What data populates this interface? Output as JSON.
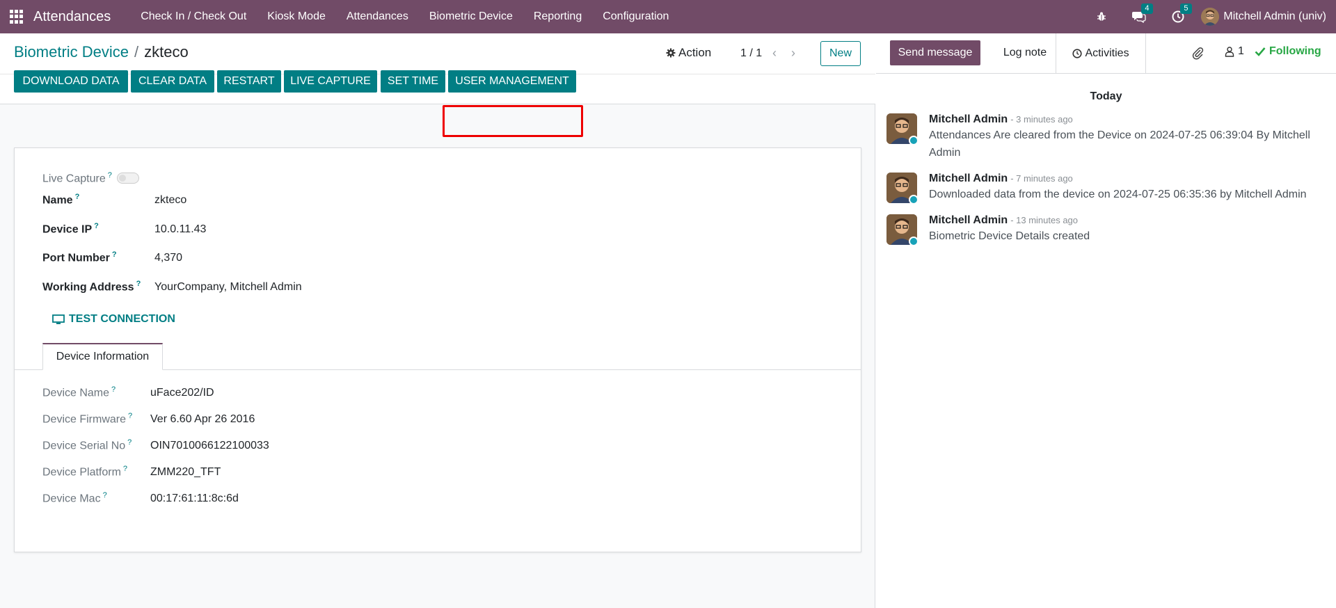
{
  "navbar": {
    "app_title": "Attendances",
    "menu": [
      "Check In / Check Out",
      "Kiosk Mode",
      "Attendances",
      "Biometric Device",
      "Reporting",
      "Configuration"
    ],
    "messages_badge": "4",
    "activities_badge": "5",
    "user_name": "Mitchell Admin (univ)"
  },
  "control": {
    "breadcrumb_parent": "Biometric Device",
    "breadcrumb_sep": "/",
    "breadcrumb_current": "zkteco",
    "action_label": "Action",
    "pager": "1 / 1",
    "new_label": "New"
  },
  "header_buttons": [
    "DOWNLOAD DATA",
    "CLEAR DATA",
    "RESTART",
    "LIVE CAPTURE",
    "SET TIME",
    "USER MANAGEMENT"
  ],
  "form": {
    "live_capture_label": "Live Capture",
    "live_capture_value": false,
    "name_label": "Name",
    "name_value": "zkteco",
    "ip_label": "Device IP",
    "ip_value": "10.0.11.43",
    "port_label": "Port Number",
    "port_value": "4,370",
    "address_label": "Working Address",
    "address_value": "YourCompany, Mitchell Admin",
    "test_button": "TEST CONNECTION",
    "tab_label": "Device Information",
    "device_name_label": "Device Name",
    "device_name_value": "uFace202/ID",
    "firmware_label": "Device Firmware",
    "firmware_value": "Ver 6.60 Apr 26 2016",
    "serial_label": "Device Serial No",
    "serial_value": "OIN7010066122100033",
    "platform_label": "Device Platform",
    "platform_value": "ZMM220_TFT",
    "mac_label": "Device Mac",
    "mac_value": "00:17:61:11:8c:6d",
    "help_mark": "?"
  },
  "chatter": {
    "send_message": "Send message",
    "log_note": "Log note",
    "activities": "Activities",
    "followers_count": "1",
    "following": "Following",
    "date_separator": "Today",
    "messages": [
      {
        "author": "Mitchell Admin",
        "time": "- 3 minutes ago",
        "text": "Attendances Are cleared from the Device on 2024-07-25 06:39:04 By Mitchell Admin"
      },
      {
        "author": "Mitchell Admin",
        "time": "- 7 minutes ago",
        "text": "Downloaded data from the device on 2024-07-25 06:35:36 by Mitchell Admin"
      },
      {
        "author": "Mitchell Admin",
        "time": "- 13 minutes ago",
        "text": "Biometric Device Details created"
      }
    ]
  },
  "colors": {
    "navbar": "#714b67",
    "primary": "#017e84",
    "highlight": "#ee0000",
    "following": "#28a745"
  }
}
